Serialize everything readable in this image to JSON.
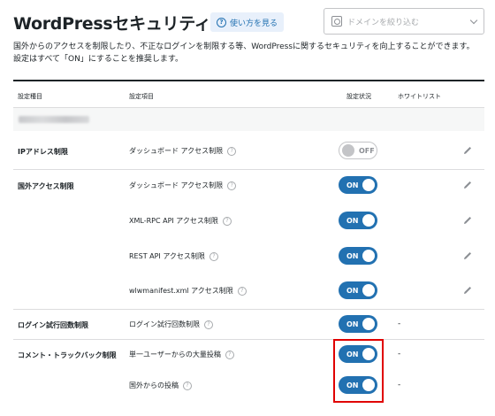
{
  "header": {
    "title": "WordPressセキュリティ設定",
    "howto_label": "使い方を見る",
    "domain_placeholder": "ドメインを絞り込む"
  },
  "description": {
    "line1": "国外からのアクセスを制限したり、不正なログインを制限する等、WordPressに関するセキュリティを向上することができます。",
    "line2": "設定はすべて「ON」にすることを推奨します。"
  },
  "table": {
    "col_group": "設定種目",
    "col_item": "設定項目",
    "col_status": "設定状況",
    "col_whitelist": "ホワイトリスト"
  },
  "rows": [
    {
      "group": "IPアドレス制限",
      "item": "ダッシュボード アクセス制限",
      "status": "OFF",
      "whitelist": ""
    },
    {
      "group": "国外アクセス制限",
      "item": "ダッシュボード アクセス制限",
      "status": "ON",
      "whitelist": ""
    },
    {
      "group": "",
      "item": "XML-RPC API アクセス制限",
      "status": "ON",
      "whitelist": ""
    },
    {
      "group": "",
      "item": "REST API アクセス制限",
      "status": "ON",
      "whitelist": ""
    },
    {
      "group": "",
      "item": "wlwmanifest.xml アクセス制限",
      "status": "ON",
      "whitelist": ""
    },
    {
      "group": "ログイン試行回数制限",
      "item": "ログイン試行回数制限",
      "status": "ON",
      "whitelist": "-"
    },
    {
      "group": "コメント・トラックバック制限",
      "item": "単一ユーザーからの大量投稿",
      "status": "ON",
      "whitelist": "-"
    },
    {
      "group": "",
      "item": "国外からの投稿",
      "status": "ON",
      "whitelist": "-"
    }
  ],
  "colors": {
    "toggle_on": "#2271b1",
    "highlight": "#e00000"
  }
}
